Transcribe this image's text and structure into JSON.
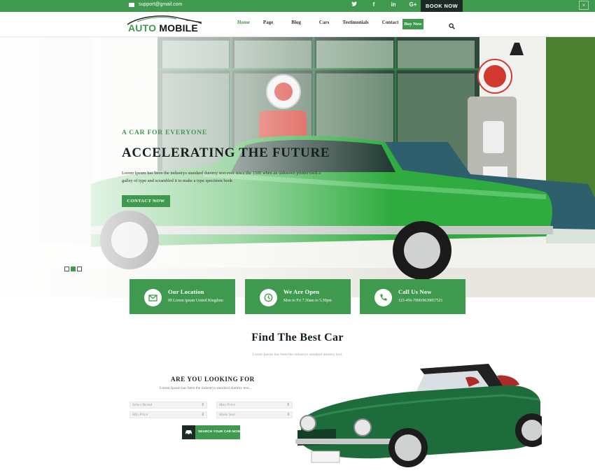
{
  "topbar": {
    "email": "support@gmail.com",
    "socials": [
      "twitter",
      "f",
      "in",
      "G+"
    ],
    "book_now": "BOOK NOW",
    "close": "×"
  },
  "navbar": {
    "logo": {
      "word1": "AUTO",
      "word2": "MOBILE"
    },
    "items": [
      "Home",
      "Page",
      "Blog",
      "Cars",
      "Testimonials",
      "Contact"
    ],
    "active": "Home",
    "buy_now": "Buy Now"
  },
  "hero": {
    "tagline": "A CAR FOR EVERYONE",
    "headline": "ACCELERATING THE FUTURE",
    "description": "Lorem Ipsum has been the industrys standard dummy text ever since the 1500 when an unknown printer took a galley of type and scrambled it to make a type specimen book",
    "cta": "CONTACT NOW",
    "slides": 3,
    "active_slide": 2,
    "pump_signs": [
      "FIRE-CHIEF",
      "TEXACO",
      "ETHYL"
    ]
  },
  "cards": [
    {
      "icon": "mail-icon",
      "title": "Our Location",
      "text": "09 Lorem ipsum United Kingdom"
    },
    {
      "icon": "clock-icon",
      "title": "We Are Open",
      "text": "Mon to Fri 7.30am to 5.30pm"
    },
    {
      "icon": "phone-icon",
      "title": "Call Us Now",
      "text": "123-456-7890/9639857521"
    }
  ],
  "find": {
    "title": "Find The Best Car",
    "subtitle": "Lorem Ipsum has been the industrys standard dummy text."
  },
  "search": {
    "title": "ARE YOU LOOKING FOR",
    "subtitle": "Lorem Ipsum has been the industrys standard dummy text...",
    "fields": [
      "Select Brand",
      "Max Price",
      "Min Price",
      "Make Year"
    ],
    "button": "SEARCH YOUR CAR NOW"
  },
  "colors": {
    "brand_green": "#3f9a4f",
    "dark": "#1d2a26"
  }
}
